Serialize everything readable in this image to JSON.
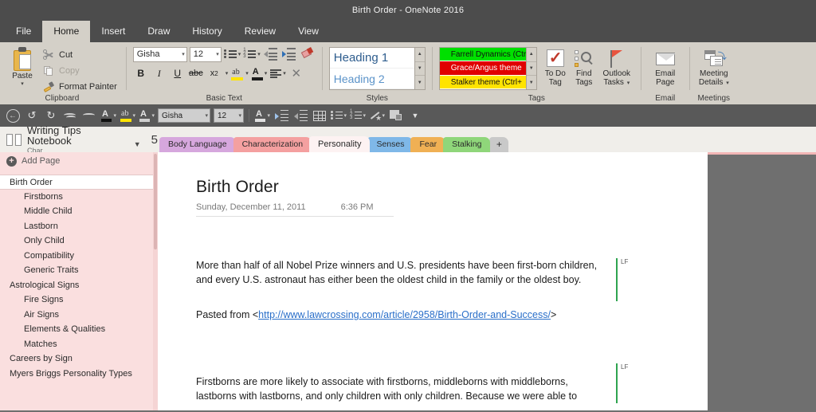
{
  "window": {
    "title": "Birth Order  -  OneNote 2016"
  },
  "ribbon": {
    "tabs": [
      {
        "label": "File",
        "active": false
      },
      {
        "label": "Home",
        "active": true
      },
      {
        "label": "Insert",
        "active": false
      },
      {
        "label": "Draw",
        "active": false
      },
      {
        "label": "History",
        "active": false
      },
      {
        "label": "Review",
        "active": false
      },
      {
        "label": "View",
        "active": false
      }
    ],
    "clipboard": {
      "group_label": "Clipboard",
      "paste_label": "Paste",
      "cut_label": "Cut",
      "copy_label": "Copy",
      "format_painter_label": "Format Painter"
    },
    "basic_text": {
      "group_label": "Basic Text",
      "font_name": "Gisha",
      "font_size": "12",
      "bold": "B",
      "italic": "I",
      "underline": "U",
      "strikethrough": "abc",
      "subscript": "x"
    },
    "styles": {
      "group_label": "Styles",
      "items": [
        {
          "label": "Heading 1"
        },
        {
          "label": "Heading 2"
        }
      ]
    },
    "tags": {
      "group_label": "Tags",
      "items": [
        {
          "label": "Farrell Dynamics (Ctr",
          "color": "#00e000"
        },
        {
          "label": "Grace/Angus theme",
          "color": "#e00000"
        },
        {
          "label": "Stalker theme (Ctrl+",
          "color": "#ffe400"
        }
      ],
      "to_do_tag_label": "To Do\nTag",
      "to_do_line1": "To Do",
      "to_do_line2": "Tag",
      "find_line1": "Find",
      "find_line2": "Tags",
      "outlook_line1": "Outlook",
      "outlook_line2": "Tasks"
    },
    "email": {
      "group_label": "Email",
      "line1": "Email",
      "line2": "Page"
    },
    "meetings": {
      "group_label": "Meetings",
      "line1": "Meeting",
      "line2": "Details"
    }
  },
  "quick_toolbar": {
    "font_name": "Gisha",
    "font_size": "12"
  },
  "notebook": {
    "name": "Writing Tips Notebook",
    "subtitle": "Char",
    "count": "5"
  },
  "section_tabs": [
    {
      "label": "Body Language",
      "color": "#d6a7dd",
      "active": false
    },
    {
      "label": "Characterization",
      "color": "#f4a0a0",
      "active": false
    },
    {
      "label": "Personality",
      "color": "#fdf2f2",
      "active": true
    },
    {
      "label": "Senses",
      "color": "#7fb8e8",
      "active": false
    },
    {
      "label": "Fear",
      "color": "#f0b054",
      "active": false
    },
    {
      "label": "Stalking",
      "color": "#8fd67a",
      "active": false
    }
  ],
  "add_section_label": "+",
  "page_list": {
    "add_page_label": "Add Page",
    "items": [
      {
        "label": "Birth Order",
        "level": 1,
        "selected": true
      },
      {
        "label": "Firstborns",
        "level": 2,
        "selected": false
      },
      {
        "label": "Middle Child",
        "level": 2,
        "selected": false
      },
      {
        "label": "Lastborn",
        "level": 2,
        "selected": false
      },
      {
        "label": "Only Child",
        "level": 2,
        "selected": false
      },
      {
        "label": "Compatibility",
        "level": 2,
        "selected": false
      },
      {
        "label": "Generic Traits",
        "level": 2,
        "selected": false
      },
      {
        "label": "Astrological Signs",
        "level": 1,
        "selected": false
      },
      {
        "label": "Fire Signs",
        "level": 2,
        "selected": false
      },
      {
        "label": "Air Signs",
        "level": 2,
        "selected": false
      },
      {
        "label": "Elements & Qualities",
        "level": 2,
        "selected": false
      },
      {
        "label": "Matches",
        "level": 2,
        "selected": false
      },
      {
        "label": "Careers by Sign",
        "level": 1,
        "selected": false
      },
      {
        "label": "Myers Briggs Personality Types",
        "level": 1,
        "selected": false
      }
    ]
  },
  "page": {
    "title": "Birth Order",
    "date": "Sunday, December 11, 2011",
    "time": "6:36 PM",
    "paragraph1": "More than half of all Nobel Prize winners and U.S. presidents have been first-born children, and every U.S. astronaut has either been the oldest child in the family or the oldest boy.",
    "pasted_prefix": "Pasted from  <",
    "pasted_url": "http://www.lawcrossing.com/article/2958/Birth-Order-and-Success/",
    "pasted_suffix": ">",
    "paragraph2": "Firstborns are more likely to associate with firstborns, middleborns with middleborns, lastborns with lastborns, and only children with only children. Because we were able to",
    "author_initials": "LF"
  }
}
